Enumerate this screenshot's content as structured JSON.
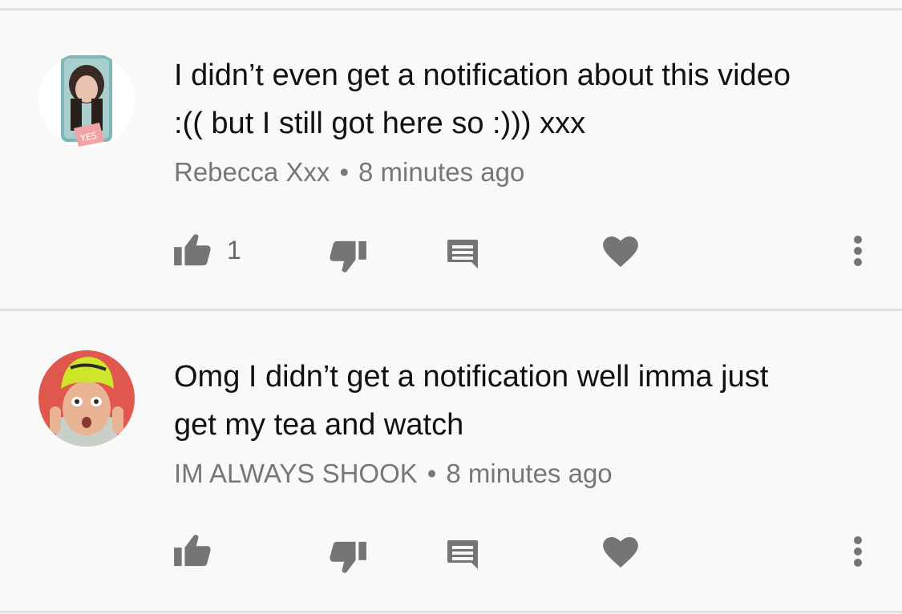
{
  "comments": [
    {
      "text_line1": "I didn’t even get a notification about this video",
      "text_line2": ":(( but I still got here so :))) xxx",
      "author": "Rebecca Xxx",
      "separator": "•",
      "time": "8 minutes ago",
      "like_count": "1",
      "avatar_badge": "YES"
    },
    {
      "text_line1": "Omg I didn’t get a notification well imma just",
      "text_line2": "get my tea and watch",
      "author": "IM ALWAYS SHOOK",
      "separator": "•",
      "time": "8 minutes ago",
      "like_count": ""
    }
  ],
  "icons": {
    "like": "thumbs-up-icon",
    "dislike": "thumbs-down-icon",
    "reply": "reply-comment-icon",
    "heart": "heart-icon",
    "more": "more-vertical-icon"
  },
  "colors": {
    "background": "#f9f9f9",
    "divider": "#e2e2e2",
    "text": "#111111",
    "meta": "#777777",
    "icon": "#757575"
  }
}
